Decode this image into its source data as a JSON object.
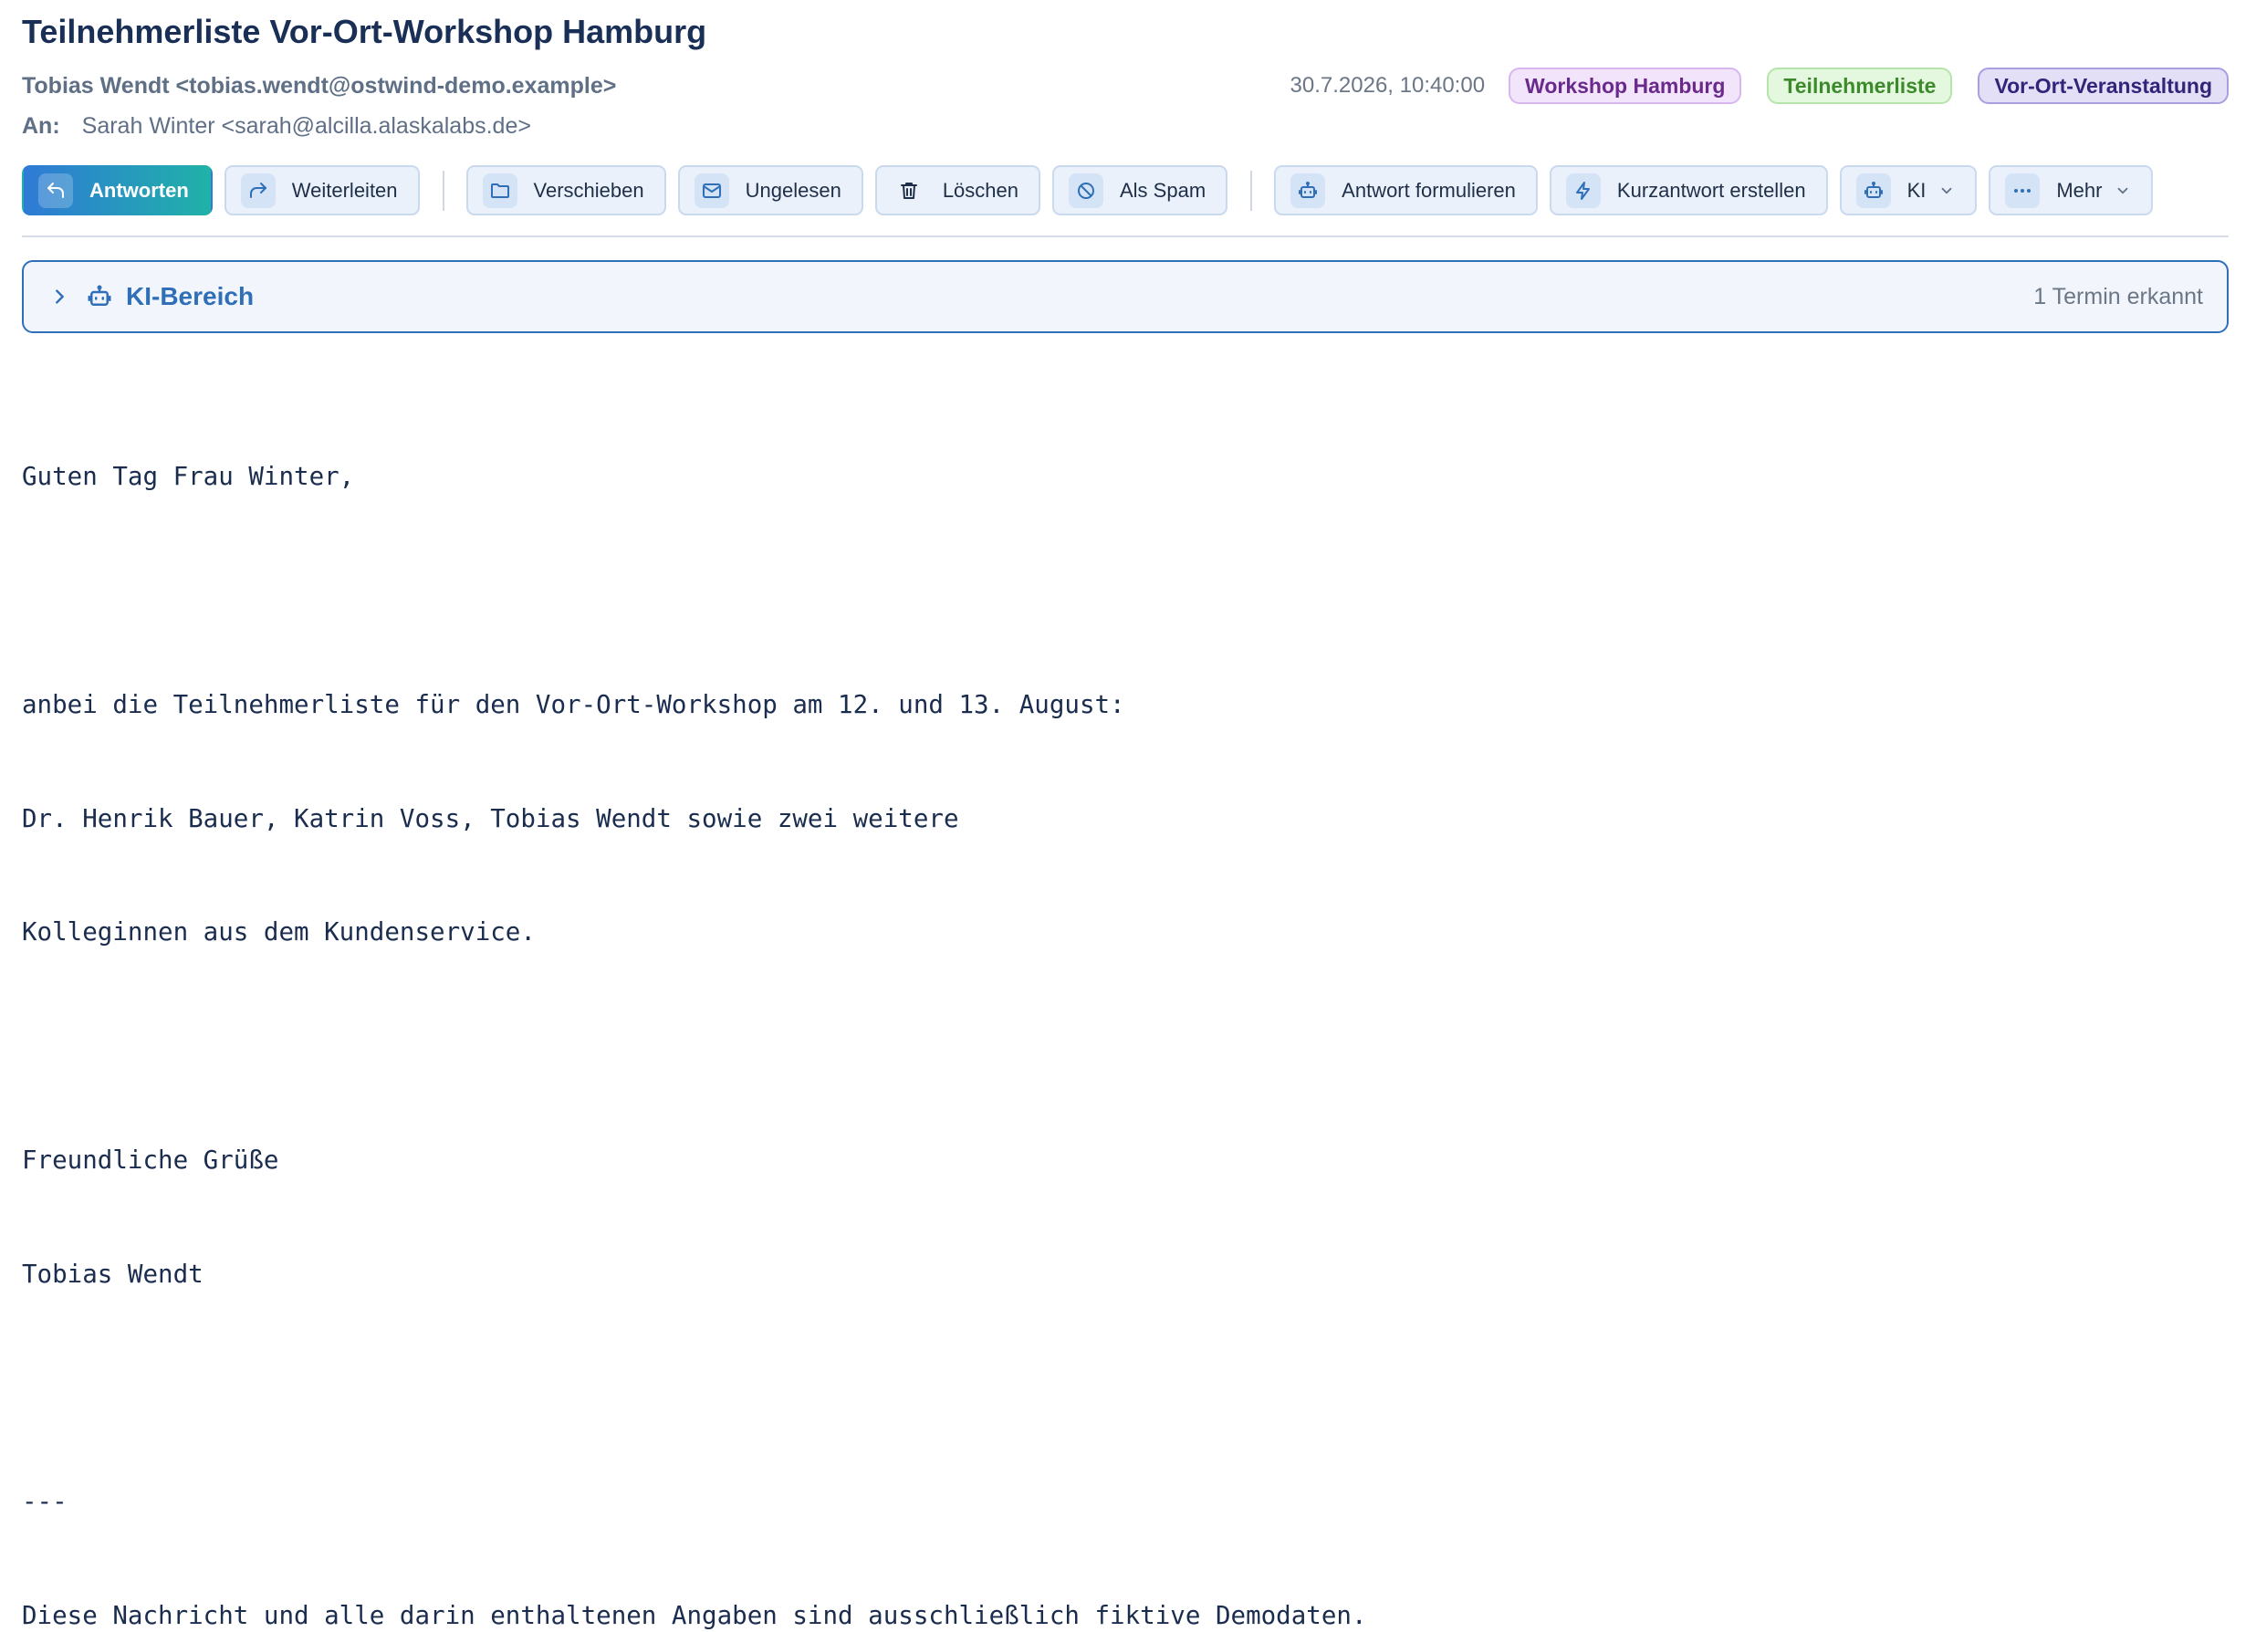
{
  "email": {
    "subject": "Teilnehmerliste Vor-Ort-Workshop Hamburg",
    "from": "Tobias Wendt <tobias.wendt@ostwind-demo.example>",
    "date": "30.7.2026, 10:40:00",
    "to_label": "An:",
    "to": "Sarah Winter <sarah@alcilla.alaskalabs.de>",
    "tags": [
      {
        "label": "Workshop Hamburg",
        "color": "#6a2a8c"
      },
      {
        "label": "Teilnehmerliste",
        "color": "#3d8a2c"
      },
      {
        "label": "Vor-Ort-Veranstaltung",
        "color": "#33247a"
      }
    ]
  },
  "toolbar": {
    "reply": {
      "label": "Antworten",
      "icon": "reply-icon"
    },
    "forward": {
      "label": "Weiterleiten",
      "icon": "forward-icon"
    },
    "move": {
      "label": "Verschieben",
      "icon": "folder-icon"
    },
    "unread": {
      "label": "Ungelesen",
      "icon": "envelope-icon"
    },
    "delete": {
      "label": "Löschen",
      "icon": "trash-icon"
    },
    "spam": {
      "label": "Als Spam",
      "icon": "block-icon"
    },
    "compose_reply": {
      "label": "Antwort formulieren",
      "icon": "robot-icon"
    },
    "quick_reply": {
      "label": "Kurzantwort erstellen",
      "icon": "lightning-icon"
    },
    "ai": {
      "label": "KI",
      "icon": "robot-icon"
    },
    "more": {
      "label": "Mehr",
      "icon": "dots-icon"
    }
  },
  "ai_panel": {
    "title": "KI-Bereich",
    "status": "1 Termin erkannt"
  },
  "body": {
    "lines": [
      "Guten Tag Frau Winter,",
      "",
      "anbei die Teilnehmerliste für den Vor-Ort-Workshop am 12. und 13. August:",
      "Dr. Henrik Bauer, Katrin Voss, Tobias Wendt sowie zwei weitere",
      "Kolleginnen aus dem Kundenservice.",
      "",
      "Freundliche Grüße",
      "Tobias Wendt",
      "",
      "---",
      "Diese Nachricht und alle darin enthaltenen Angaben sind ausschließlich fiktive Demodaten."
    ]
  },
  "colors": {
    "accent": "#2f6fb8",
    "primary_gradient_start": "#2f7ad6",
    "primary_gradient_end": "#20b2a8"
  }
}
